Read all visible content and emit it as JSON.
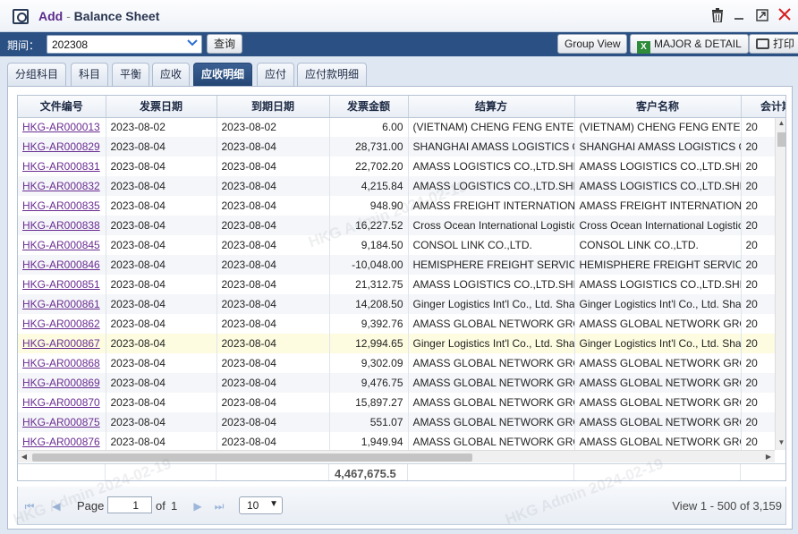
{
  "titlebar": {
    "add": "Add",
    "sep": " - ",
    "title": "Balance Sheet"
  },
  "toolbar": {
    "period_label": "期间：",
    "period_value": "202308",
    "query_label": "查询",
    "group_view_label": "Group View",
    "major_detail_label": "MAJOR & DETAIL",
    "print_label": "打印"
  },
  "tabs": [
    {
      "label": "分组科目"
    },
    {
      "label": "科目"
    },
    {
      "label": "平衡"
    },
    {
      "label": "应收"
    },
    {
      "label": "应收明细",
      "active": true
    },
    {
      "label": "应付"
    },
    {
      "label": "应付款明细"
    }
  ],
  "grid": {
    "columns": [
      "文件编号",
      "发票日期",
      "到期日期",
      "发票金额",
      "结算方",
      "客户名称",
      "会计期间"
    ],
    "rows": [
      [
        "HKG-AR000013",
        "2023-08-02",
        "2023-08-02",
        "6.00",
        "(VIETNAM) CHENG FENG ENTERPRISE",
        "(VIETNAM) CHENG FENG ENTERPRISE",
        "20"
      ],
      [
        "HKG-AR000829",
        "2023-08-04",
        "2023-08-04",
        "28,731.00",
        "SHANGHAI AMASS LOGISTICS CO.,LTD.",
        "SHANGHAI AMASS LOGISTICS CO.,LTD.",
        "20"
      ],
      [
        "HKG-AR000831",
        "2023-08-04",
        "2023-08-04",
        "22,702.20",
        "AMASS LOGISTICS CO.,LTD.SHENZHEN",
        "AMASS LOGISTICS CO.,LTD.SHENZHEN",
        "20"
      ],
      [
        "HKG-AR000832",
        "2023-08-04",
        "2023-08-04",
        "4,215.84",
        "AMASS LOGISTICS CO.,LTD.SHENZHEN",
        "AMASS LOGISTICS CO.,LTD.SHENZHEN",
        "20"
      ],
      [
        "HKG-AR000835",
        "2023-08-04",
        "2023-08-04",
        "948.90",
        "AMASS FREIGHT INTERNATIONAL",
        "AMASS FREIGHT INTERNATIONAL",
        "20"
      ],
      [
        "HKG-AR000838",
        "2023-08-04",
        "2023-08-04",
        "16,227.52",
        "Cross Ocean International Logistics",
        "Cross Ocean International Logistics",
        "20"
      ],
      [
        "HKG-AR000845",
        "2023-08-04",
        "2023-08-04",
        "9,184.50",
        "CONSOL LINK CO.,LTD.",
        "CONSOL LINK CO.,LTD.",
        "20"
      ],
      [
        "HKG-AR000846",
        "2023-08-04",
        "2023-08-04",
        "-10,048.00",
        "HEMISPHERE FREIGHT SERVICES",
        "HEMISPHERE FREIGHT SERVICES",
        "20"
      ],
      [
        "HKG-AR000851",
        "2023-08-04",
        "2023-08-04",
        "21,312.75",
        "AMASS LOGISTICS CO.,LTD.SHENZHEN",
        "AMASS LOGISTICS CO.,LTD.SHENZHEN",
        "20"
      ],
      [
        "HKG-AR000861",
        "2023-08-04",
        "2023-08-04",
        "14,208.50",
        "Ginger Logistics Int'l Co., Ltd. Shanghai",
        "Ginger Logistics Int'l Co., Ltd. Shanghai",
        "20"
      ],
      [
        "HKG-AR000862",
        "2023-08-04",
        "2023-08-04",
        "9,392.76",
        "AMASS GLOBAL NETWORK GROUP",
        "AMASS GLOBAL NETWORK GROUP",
        "20"
      ],
      [
        "HKG-AR000867",
        "2023-08-04",
        "2023-08-04",
        "12,994.65",
        "Ginger Logistics Int'l Co., Ltd. Shanghai",
        "Ginger Logistics Int'l Co., Ltd. Shanghai",
        "20"
      ],
      [
        "HKG-AR000868",
        "2023-08-04",
        "2023-08-04",
        "9,302.09",
        "AMASS GLOBAL NETWORK GROUP",
        "AMASS GLOBAL NETWORK GROUP",
        "20"
      ],
      [
        "HKG-AR000869",
        "2023-08-04",
        "2023-08-04",
        "9,476.75",
        "AMASS GLOBAL NETWORK GROUP",
        "AMASS GLOBAL NETWORK GROUP",
        "20"
      ],
      [
        "HKG-AR000870",
        "2023-08-04",
        "2023-08-04",
        "15,897.27",
        "AMASS GLOBAL NETWORK GROUP",
        "AMASS GLOBAL NETWORK GROUP",
        "20"
      ],
      [
        "HKG-AR000875",
        "2023-08-04",
        "2023-08-04",
        "551.07",
        "AMASS GLOBAL NETWORK GROUP",
        "AMASS GLOBAL NETWORK GROUP",
        "20"
      ],
      [
        "HKG-AR000876",
        "2023-08-04",
        "2023-08-04",
        "1,949.94",
        "AMASS GLOBAL NETWORK GROUP",
        "AMASS GLOBAL NETWORK GROUP",
        "20"
      ]
    ],
    "highlight_row": 11,
    "total": "4,467,675.5"
  },
  "pager": {
    "page_label": "Page",
    "page_value": "1",
    "of_label": "of",
    "total_pages": "1",
    "page_size": "10",
    "view_text": "View 1 - 500 of 3,159"
  },
  "watermark": "HKG Admin 2024-02-19",
  "colors": {
    "toolbar_bg": "#2b5083",
    "tab_active": "#244775",
    "link": "#6a2c91"
  }
}
